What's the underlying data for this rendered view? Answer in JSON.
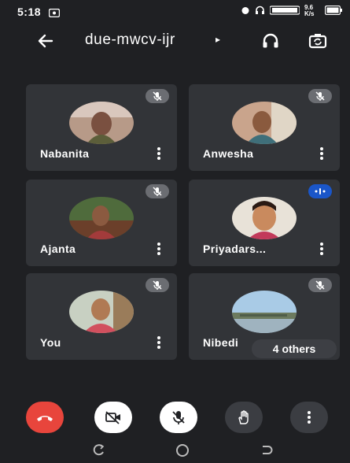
{
  "status_bar": {
    "time": "5:18",
    "battery": "9.6 K/s"
  },
  "header": {
    "meeting_code": "due-mwcv-ijr"
  },
  "participants": [
    {
      "name": "Nabanita"
    },
    {
      "name": "Anwesha"
    },
    {
      "name": "Ajanta"
    },
    {
      "name": "Priyadars..."
    },
    {
      "name": "You"
    },
    {
      "name": "Nibedi"
    }
  ],
  "others_badge": "4 others",
  "colors": {
    "background": "#1f2023",
    "tile": "#323438",
    "end_call": "#e8453c",
    "speaking": "#1a56c9"
  },
  "icons": {
    "back": "arrow-left-icon",
    "audio": "headphones-icon",
    "camera_switch": "camera-switch-icon",
    "end_call": "phone-hangup-icon",
    "video_off": "video-off-icon",
    "mic_off": "mic-off-icon",
    "raise_hand": "hand-icon",
    "more": "more-vertical-icon"
  }
}
